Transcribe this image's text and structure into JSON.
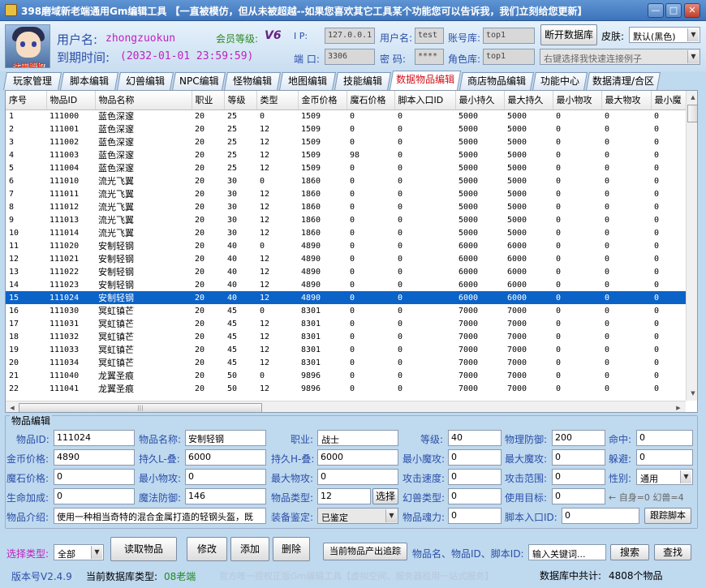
{
  "window": {
    "title": "398磨域新老端通用Gm编辑工具 【一直被模仿，但从未被超越--如果您喜欢其它工具某个功能您可以告诉我，我们立刻给您更新】",
    "min": "—",
    "max": "□",
    "close": "✕"
  },
  "header": {
    "avatar_caption": "注册授权",
    "username_label": "用户名:",
    "username": "zhongzuokun",
    "expire_label": "到期时间:",
    "expire": "(2032-01-01 23:59:59)",
    "member_label": "会员等级:",
    "member_level": "V6",
    "ip_label": "I  P:",
    "ip": "127.0.0.1",
    "port_label": "端 口:",
    "port": "3306",
    "db_user_label": "用户名:",
    "db_user": "test",
    "password_label": "密  码:",
    "password": "****",
    "account_db_label": "账号库:",
    "account_db": "top1",
    "role_db_label": "角色库:",
    "role_db": "top1",
    "open_db_button": "断开数据库",
    "skin_label": "皮肤:",
    "skin_value": "默认(黑色)",
    "quick_connect": "右键选择我快速连接例子"
  },
  "tabs": [
    "玩家管理",
    "脚本编辑",
    "幻兽编辑",
    "NPC编辑",
    "怪物编辑",
    "地图编辑",
    "技能编辑",
    "数据物品编辑",
    "商店物品编辑",
    "功能中心",
    "数据清理/合区"
  ],
  "active_tab": 7,
  "table": {
    "columns": [
      "序号",
      "物品ID",
      "物品名称",
      "职业",
      "等级",
      "类型",
      "金币价格",
      "魔石价格",
      "脚本入口ID",
      "最小持久",
      "最大持久",
      "最小物攻",
      "最大物攻",
      "最小魔"
    ],
    "selected_row": 14,
    "rows": [
      [
        "1",
        "111000",
        "蓝色深邃",
        "20",
        "25",
        "0",
        "1509",
        "0",
        "0",
        "5000",
        "5000",
        "0",
        "0",
        "0"
      ],
      [
        "2",
        "111001",
        "蓝色深邃",
        "20",
        "25",
        "12",
        "1509",
        "0",
        "0",
        "5000",
        "5000",
        "0",
        "0",
        "0"
      ],
      [
        "3",
        "111002",
        "蓝色深邃",
        "20",
        "25",
        "12",
        "1509",
        "0",
        "0",
        "5000",
        "5000",
        "0",
        "0",
        "0"
      ],
      [
        "4",
        "111003",
        "蓝色深邃",
        "20",
        "25",
        "12",
        "1509",
        "98",
        "0",
        "5000",
        "5000",
        "0",
        "0",
        "0"
      ],
      [
        "5",
        "111004",
        "蓝色深邃",
        "20",
        "25",
        "12",
        "1509",
        "0",
        "0",
        "5000",
        "5000",
        "0",
        "0",
        "0"
      ],
      [
        "6",
        "111010",
        "流光飞翼",
        "20",
        "30",
        "0",
        "1860",
        "0",
        "0",
        "5000",
        "5000",
        "0",
        "0",
        "0"
      ],
      [
        "7",
        "111011",
        "流光飞翼",
        "20",
        "30",
        "12",
        "1860",
        "0",
        "0",
        "5000",
        "5000",
        "0",
        "0",
        "0"
      ],
      [
        "8",
        "111012",
        "流光飞翼",
        "20",
        "30",
        "12",
        "1860",
        "0",
        "0",
        "5000",
        "5000",
        "0",
        "0",
        "0"
      ],
      [
        "9",
        "111013",
        "流光飞翼",
        "20",
        "30",
        "12",
        "1860",
        "0",
        "0",
        "5000",
        "5000",
        "0",
        "0",
        "0"
      ],
      [
        "10",
        "111014",
        "流光飞翼",
        "20",
        "30",
        "12",
        "1860",
        "0",
        "0",
        "5000",
        "5000",
        "0",
        "0",
        "0"
      ],
      [
        "11",
        "111020",
        "安制轻钢",
        "20",
        "40",
        "0",
        "4890",
        "0",
        "0",
        "6000",
        "6000",
        "0",
        "0",
        "0"
      ],
      [
        "12",
        "111021",
        "安制轻钢",
        "20",
        "40",
        "12",
        "4890",
        "0",
        "0",
        "6000",
        "6000",
        "0",
        "0",
        "0"
      ],
      [
        "13",
        "111022",
        "安制轻钢",
        "20",
        "40",
        "12",
        "4890",
        "0",
        "0",
        "6000",
        "6000",
        "0",
        "0",
        "0"
      ],
      [
        "14",
        "111023",
        "安制轻钢",
        "20",
        "40",
        "12",
        "4890",
        "0",
        "0",
        "6000",
        "6000",
        "0",
        "0",
        "0"
      ],
      [
        "15",
        "111024",
        "安制轻钢",
        "20",
        "40",
        "12",
        "4890",
        "0",
        "0",
        "6000",
        "6000",
        "0",
        "0",
        "0"
      ],
      [
        "16",
        "111030",
        "冥虹镇芒",
        "20",
        "45",
        "0",
        "8301",
        "0",
        "0",
        "7000",
        "7000",
        "0",
        "0",
        "0"
      ],
      [
        "17",
        "111031",
        "冥虹镇芒",
        "20",
        "45",
        "12",
        "8301",
        "0",
        "0",
        "7000",
        "7000",
        "0",
        "0",
        "0"
      ],
      [
        "18",
        "111032",
        "冥虹镇芒",
        "20",
        "45",
        "12",
        "8301",
        "0",
        "0",
        "7000",
        "7000",
        "0",
        "0",
        "0"
      ],
      [
        "19",
        "111033",
        "冥虹镇芒",
        "20",
        "45",
        "12",
        "8301",
        "0",
        "0",
        "7000",
        "7000",
        "0",
        "0",
        "0"
      ],
      [
        "20",
        "111034",
        "冥虹镇芒",
        "20",
        "45",
        "12",
        "8301",
        "0",
        "0",
        "7000",
        "7000",
        "0",
        "0",
        "0"
      ],
      [
        "21",
        "111040",
        "龙翼圣痕",
        "20",
        "50",
        "0",
        "9896",
        "0",
        "0",
        "7000",
        "7000",
        "0",
        "0",
        "0"
      ],
      [
        "22",
        "111041",
        "龙翼圣痕",
        "20",
        "50",
        "12",
        "9896",
        "0",
        "0",
        "7000",
        "7000",
        "0",
        "0",
        "0"
      ]
    ]
  },
  "edit": {
    "legend": "物品编辑",
    "item_id_label": "物品ID:",
    "item_id": "111024",
    "item_name_label": "物品名称:",
    "item_name": "安制轻钢",
    "job_label": "职业:",
    "job": "战士",
    "level_label": "等级:",
    "level": "40",
    "phys_def_label": "物理防御:",
    "phys_def": "200",
    "hit_label": "命中:",
    "hit": "0",
    "gold_label": "金币价格:",
    "gold": "4890",
    "dur_l_label": "持久L-叠:",
    "dur_l": "6000",
    "dur_h_label": "持久H-叠:",
    "dur_h": "6000",
    "min_matk_label": "最小魔攻:",
    "min_matk": "0",
    "max_matk_label": "最大魔攻:",
    "max_matk": "0",
    "dodge_label": "躲避:",
    "dodge": "0",
    "stone_label": "魔石价格:",
    "stone": "0",
    "min_patk_label": "最小物攻:",
    "min_patk": "0",
    "max_patk_label": "最大物攻:",
    "max_patk": "0",
    "atk_speed_label": "攻击速度:",
    "atk_speed": "0",
    "atk_range_label": "攻击范围:",
    "atk_range": "0",
    "gender_label": "性别:",
    "gender": "通用",
    "hp_add_label": "生命加成:",
    "hp_add": "0",
    "mdef_label": "魔法防御:",
    "mdef": "146",
    "type_label": "物品类型:",
    "type": "12",
    "select_button": "选择",
    "pet_type_label": "幻兽类型:",
    "pet_type": "0",
    "target_label": "使用目标:",
    "target": "0",
    "target_hint": "← 自身=0 幻兽=4",
    "desc_label": "物品介绍:",
    "desc": "使用一种相当奇特的混合金属打造的轻钢头盔，既",
    "identify_label": "装备鉴定:",
    "identify": "已鉴定",
    "soul_label": "物品魂力:",
    "soul": "0",
    "script_id_label": "脚本入口ID:",
    "script_id": "0",
    "trace_script_button": "跟踪脚本"
  },
  "bottom": {
    "select_type_label": "选择类型:",
    "select_type": "全部",
    "read_button": "读取物品",
    "modify_button": "修改",
    "add_button": "添加",
    "delete_button": "删除",
    "trace_button": "当前物品产出追踪",
    "search_hint": "物品名、物品ID、脚本ID:",
    "keyword_placeholder": "输入关键词...",
    "search_button": "搜索",
    "find_button": "查找"
  },
  "status": {
    "version": "版本号V2.4.9",
    "db_type_label": "当前数据库类型:",
    "db_type": "08老端",
    "marquee": "官方唯一授权正版Gm编辑工具【虚拟空间、服务器租用一站式服务】",
    "total_label": "数据库中共计:",
    "total": "4808个物品"
  },
  "colors": {
    "selection": "#0b63c8",
    "active_tab": "#d0101a",
    "label_blue": "#2b4fa8"
  }
}
